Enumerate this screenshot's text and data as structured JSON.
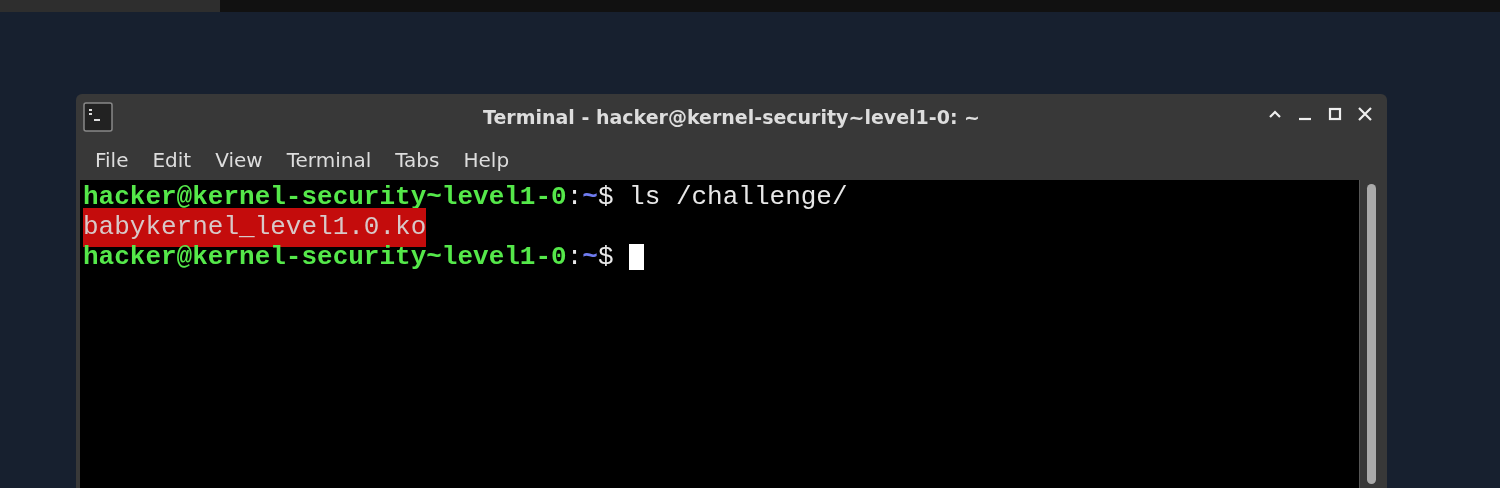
{
  "window": {
    "title": "Terminal - hacker@kernel-security~level1-0: ~",
    "controls": [
      {
        "kind": "shade"
      },
      {
        "kind": "minimize"
      },
      {
        "kind": "maximize"
      },
      {
        "kind": "close"
      }
    ]
  },
  "menu": [
    "File",
    "Edit",
    "View",
    "Terminal",
    "Tabs",
    "Help"
  ],
  "terminal": {
    "lines": [
      {
        "segments": [
          {
            "kind": "user",
            "text": "hacker@kernel-security~level1-0"
          },
          {
            "kind": "plain",
            "text": ":"
          },
          {
            "kind": "path",
            "text": "~"
          },
          {
            "kind": "plain",
            "text": "$ ls /challenge/"
          }
        ]
      },
      {
        "segments": [
          {
            "kind": "highlight",
            "text": "babykernel_level1.0.ko"
          }
        ]
      },
      {
        "segments": [
          {
            "kind": "user",
            "text": "hacker@kernel-security~level1-0"
          },
          {
            "kind": "plain",
            "text": ":"
          },
          {
            "kind": "path",
            "text": "~"
          },
          {
            "kind": "plain",
            "text": "$ "
          }
        ],
        "cursor": true
      }
    ]
  }
}
